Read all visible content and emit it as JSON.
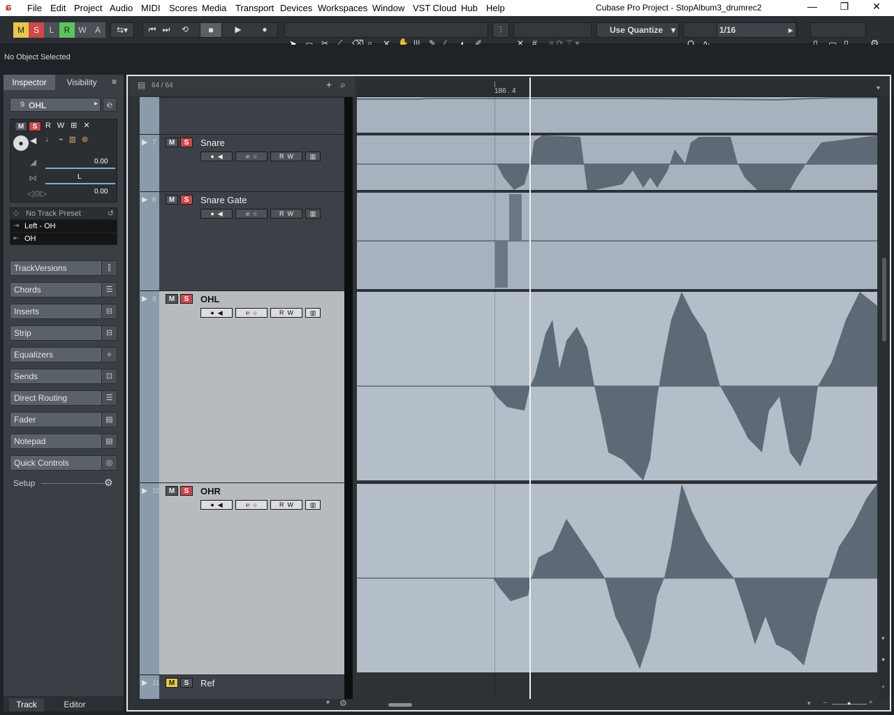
{
  "app": {
    "window_title": "Cubase Pro Project - StopAlbum3_drumrec2",
    "menu": [
      "File",
      "Edit",
      "Project",
      "Audio",
      "MIDI",
      "Scores",
      "Media",
      "Transport",
      "Devices",
      "Workspaces",
      "Window",
      "VST Cloud",
      "Hub",
      "Help"
    ]
  },
  "toolbar": {
    "modes": [
      "M",
      "S",
      "L",
      "R",
      "W",
      "A"
    ],
    "quantize_label": "Use Quantize",
    "quantize_value": "1/16"
  },
  "info_line": "No Object Selected",
  "inspector": {
    "tabs": [
      "Inspector",
      "Visibility"
    ],
    "track_number": "9",
    "track_name": "OHL",
    "volume": "0.00",
    "pan": "L",
    "delay": "0.00",
    "preset": "No Track Preset",
    "input_routing": "Left - OH",
    "output_routing": "OH",
    "sections": [
      "TrackVersions",
      "Chords",
      "Inserts",
      "Strip",
      "Equalizers",
      "Sends",
      "Direct Routing",
      "Fader",
      "Notepad",
      "Quick Controls"
    ],
    "setup_label": "Setup",
    "bottom_tabs": [
      "Track",
      "Editor"
    ]
  },
  "project": {
    "track_count": "64 / 64",
    "ruler_marker": "186 . 4",
    "tracks": [
      {
        "number": "7",
        "name": "Snare"
      },
      {
        "number": "8",
        "name": "Snare Gate"
      },
      {
        "number": "9",
        "name": "OHL"
      },
      {
        "number": "10",
        "name": "OHR"
      },
      {
        "number": "11",
        "name": "Ref"
      }
    ]
  },
  "colors": {
    "solo_active": "#d0474a",
    "mute_active": "#e6c84a",
    "lane_bg": "#a6b2bd",
    "wave_fill": "#5d6a76"
  }
}
